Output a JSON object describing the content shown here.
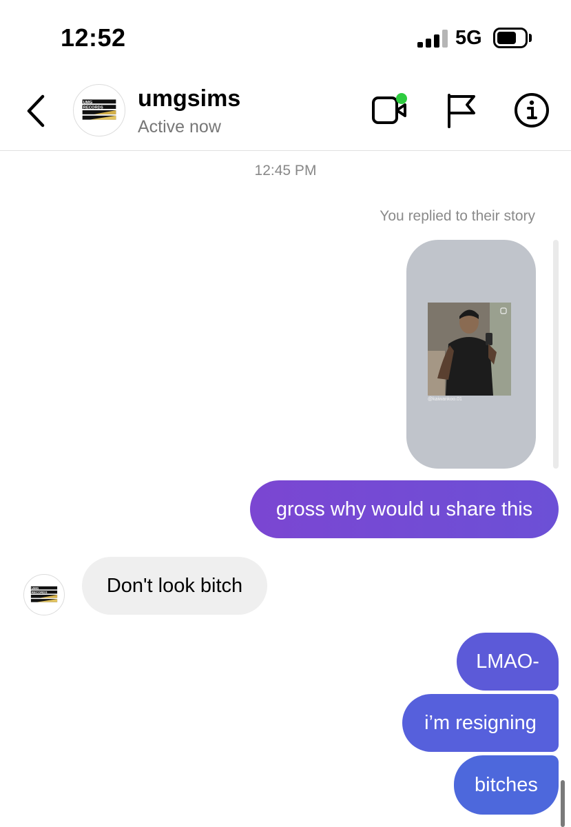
{
  "status_bar": {
    "time": "12:52",
    "network": "5G",
    "battery_level": 0.62
  },
  "header": {
    "username": "umgsims",
    "status": "Active now",
    "logo_text_top": "UMG",
    "logo_text_bottom": "RECORDS"
  },
  "thread": {
    "timestamp": "12:45 PM",
    "story_reply_label": "You replied to their story",
    "story_handle": "@kaiwankoo.01",
    "messages": [
      {
        "sender": "me",
        "text": "gross why would u share this"
      },
      {
        "sender": "them",
        "text": "Don't look bitch"
      },
      {
        "sender": "me",
        "text": "LMAO-"
      },
      {
        "sender": "me",
        "text": "i’m resigning"
      },
      {
        "sender": "me",
        "text": "bitches"
      }
    ]
  },
  "colors": {
    "accent_purple": "#7b46d2",
    "accent_blue": "#4d68dc",
    "online": "#2ecc40",
    "incoming_bubble": "#efefef"
  },
  "icons": [
    "back-arrow-icon",
    "video-call-icon",
    "flag-icon",
    "info-icon"
  ]
}
